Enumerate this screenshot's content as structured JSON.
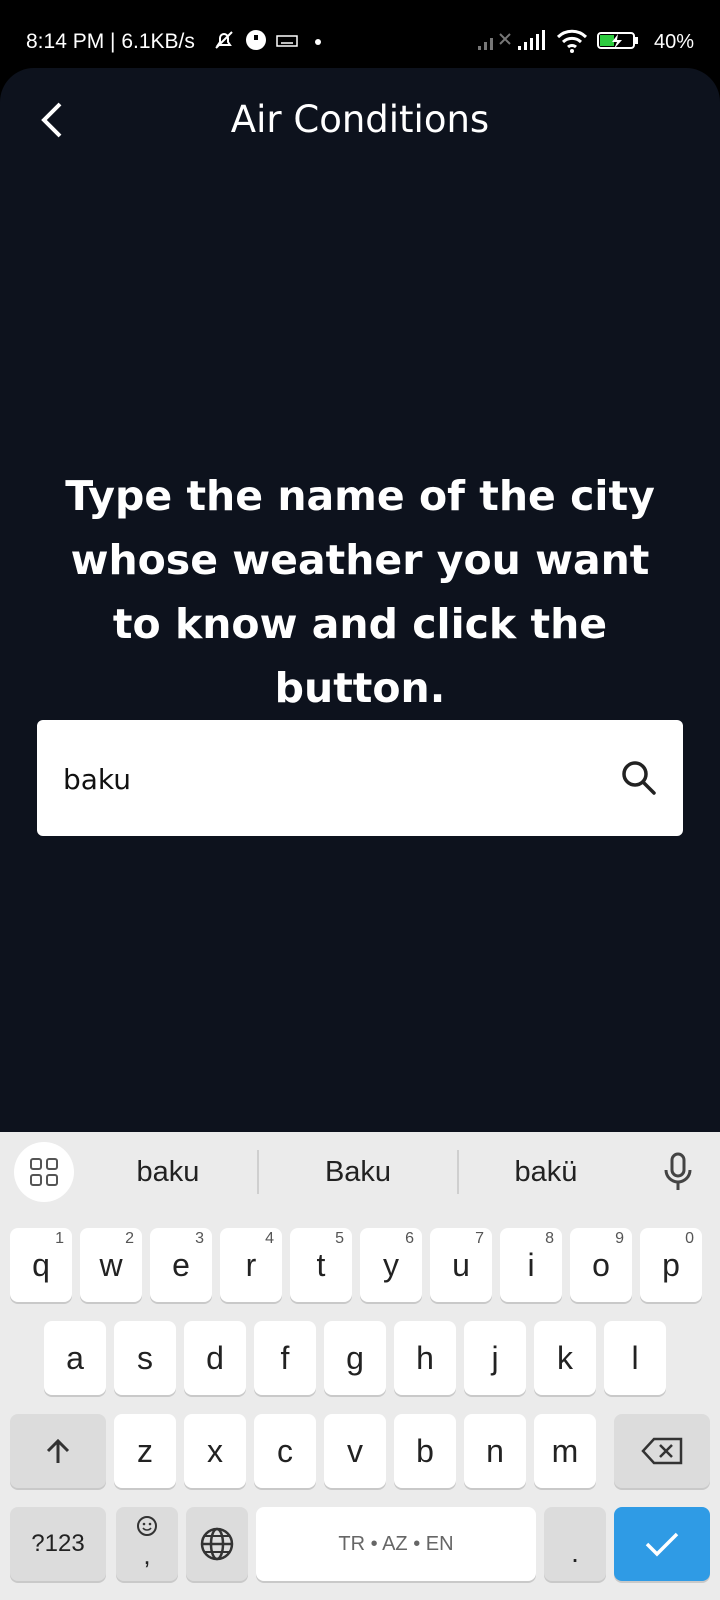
{
  "status_bar": {
    "time_speed": "8:14 PM | 6.1KB/s",
    "battery": "40%"
  },
  "header": {
    "title": "Air Conditions"
  },
  "main": {
    "instruction": "Type the name of the city whose weather you want to know and click the button.",
    "search_value": "baku"
  },
  "keyboard": {
    "suggestions": [
      "baku",
      "Baku",
      "bakü"
    ],
    "row1": [
      {
        "k": "q",
        "h": "1"
      },
      {
        "k": "w",
        "h": "2"
      },
      {
        "k": "e",
        "h": "3"
      },
      {
        "k": "r",
        "h": "4"
      },
      {
        "k": "t",
        "h": "5"
      },
      {
        "k": "y",
        "h": "6"
      },
      {
        "k": "u",
        "h": "7"
      },
      {
        "k": "i",
        "h": "8"
      },
      {
        "k": "o",
        "h": "9"
      },
      {
        "k": "p",
        "h": "0"
      }
    ],
    "row2": [
      "a",
      "s",
      "d",
      "f",
      "g",
      "h",
      "j",
      "k",
      "l"
    ],
    "row3": [
      "z",
      "x",
      "c",
      "v",
      "b",
      "n",
      "m"
    ],
    "symbols_label": "?123",
    "comma": ",",
    "space_label": "TR • AZ • EN",
    "period": "."
  }
}
